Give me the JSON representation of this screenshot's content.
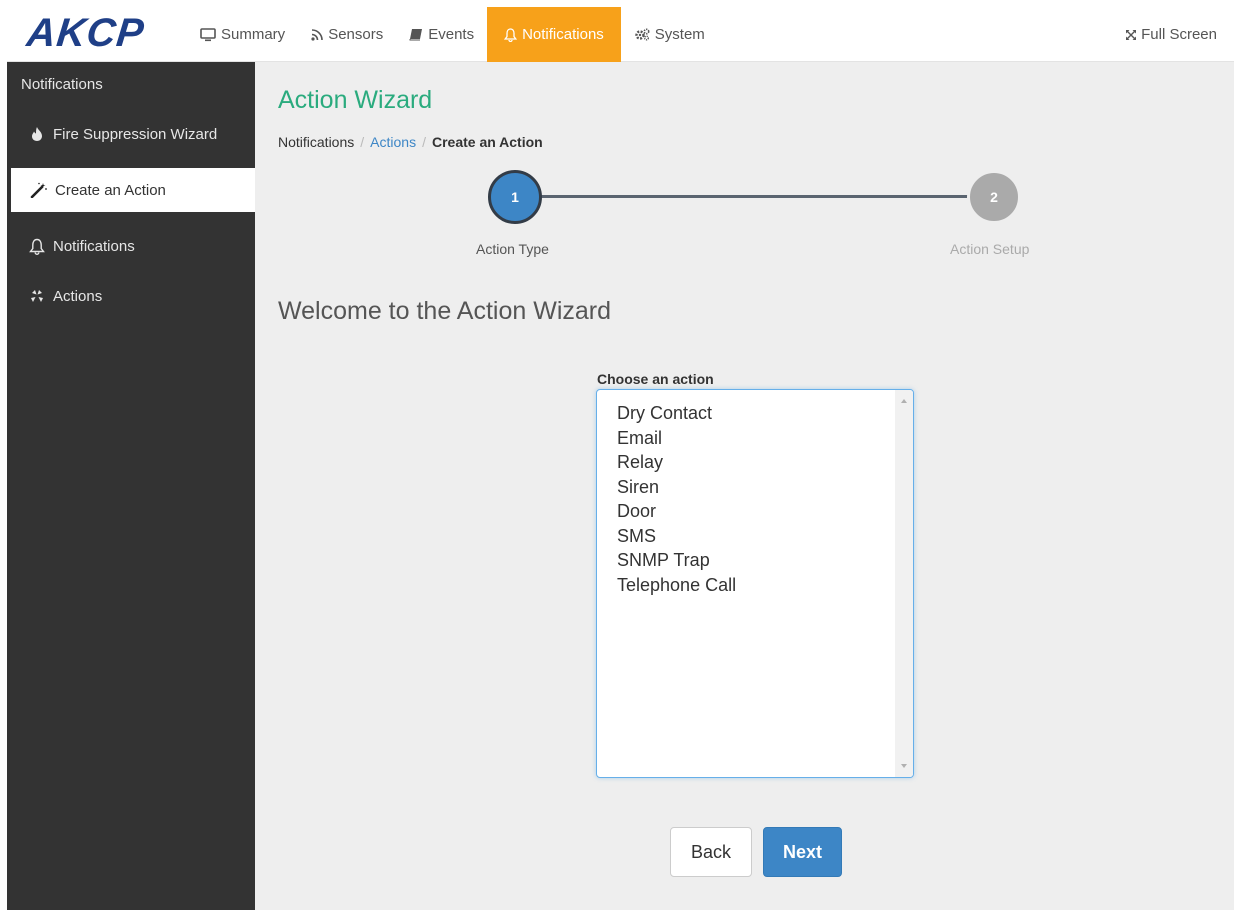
{
  "brand": {
    "logo_text": "AKCP",
    "logo_color": "#1f3f87"
  },
  "nav": {
    "items": [
      {
        "label": "Summary",
        "icon": "monitor-icon"
      },
      {
        "label": "Sensors",
        "icon": "rss-icon"
      },
      {
        "label": "Events",
        "icon": "book-icon"
      },
      {
        "label": "Notifications",
        "icon": "bell-icon",
        "active": true
      },
      {
        "label": "System",
        "icon": "gears-icon"
      }
    ],
    "fullscreen_label": "Full Screen",
    "active_color": "#f7a11a"
  },
  "sidebar": {
    "heading": "Notifications",
    "items": [
      {
        "label": "Fire Suppression Wizard",
        "icon": "fire-icon"
      },
      {
        "label": "Create an Action",
        "icon": "magic-wand-icon",
        "active": true
      },
      {
        "label": "Notifications",
        "icon": "bell-icon"
      },
      {
        "label": "Actions",
        "icon": "actions-icon"
      }
    ]
  },
  "main": {
    "title": "Action Wizard",
    "breadcrumb": {
      "root": "Notifications",
      "link": "Actions",
      "current": "Create an Action",
      "separator": "/"
    },
    "steps": [
      {
        "number": "1",
        "label": "Action Type",
        "active": true
      },
      {
        "number": "2",
        "label": "Action Setup",
        "active": false
      }
    ],
    "welcome": "Welcome to the Action Wizard",
    "choose_label": "Choose an action",
    "actions": [
      "Dry Contact",
      "Email",
      "Relay",
      "Siren",
      "Door",
      "SMS",
      "SNMP Trap",
      "Telephone Call"
    ],
    "buttons": {
      "back": "Back",
      "next": "Next"
    }
  },
  "colors": {
    "title_green": "#2aab7e",
    "primary_blue": "#3d86c6",
    "sidebar_bg": "#333333"
  }
}
